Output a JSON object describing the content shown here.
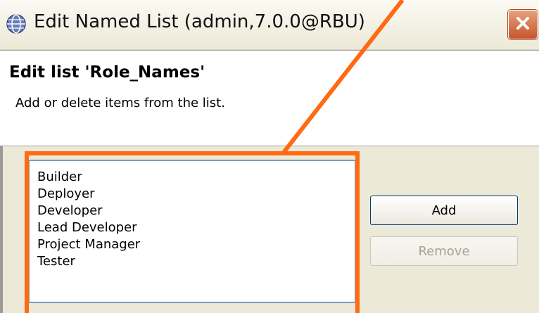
{
  "window": {
    "title": "Edit Named List (admin,7.0.0@RBU)"
  },
  "header": {
    "title": "Edit list 'Role_Names'",
    "description": "Add or delete items from the list."
  },
  "list": {
    "items": [
      "Builder",
      "Deployer",
      "Developer",
      "Lead Developer",
      "Project Manager",
      "Tester"
    ]
  },
  "buttons": {
    "add": "Add",
    "remove": "Remove",
    "remove_enabled": false
  },
  "annotation": {
    "color": "#ff6a13"
  },
  "icons": {
    "title": "globe-icon",
    "close": "close-icon"
  }
}
